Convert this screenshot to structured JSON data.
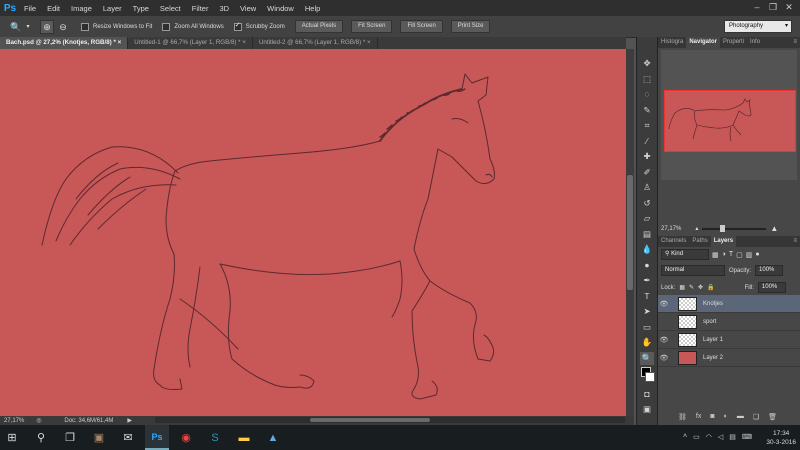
{
  "menubar": {
    "logo": "Ps",
    "items": [
      "File",
      "Edit",
      "Image",
      "Layer",
      "Type",
      "Select",
      "Filter",
      "3D",
      "View",
      "Window",
      "Help"
    ]
  },
  "options": {
    "resize_windows": "Resize Windows to Fit",
    "zoom_all": "Zoom All Windows",
    "scrubby_zoom": "Scrubby Zoom",
    "actual_pixels": "Actual Pixels",
    "fit_screen": "Fit Screen",
    "fill_screen": "Fill Screen",
    "print_size": "Print Size",
    "workspace": "Photography",
    "scrubby_checked": true
  },
  "tabs": [
    {
      "label": "Bach.psd @ 27,2% (Knotjes, RGB/8) *",
      "active": true
    },
    {
      "label": "Untitled-1 @ 66,7% (Layer 1, RGB/8) *",
      "active": false
    },
    {
      "label": "Untitled-2 @ 66,7% (Layer 1, RGB/8) *",
      "active": false
    }
  ],
  "canvas": {
    "color": "#c85757"
  },
  "status": {
    "zoom": "27,17%",
    "doc": "Doc: 34,6M/61,4M"
  },
  "nav_panel": {
    "tabs": [
      "Histogra",
      "Navigator",
      "Properti",
      "Info"
    ],
    "zoom": "27,17%"
  },
  "layers_panel": {
    "tabs": [
      "Channels",
      "Paths",
      "Layers"
    ],
    "filter": "Kind",
    "blend_mode": "Normal",
    "opacity_label": "Opacity:",
    "opacity": "100%",
    "lock_label": "Lock:",
    "fill_label": "Fill:",
    "fill": "100%",
    "layers": [
      {
        "name": "Knotjes",
        "visible": true,
        "selected": true,
        "thumb": "transparent"
      },
      {
        "name": "sport",
        "visible": false,
        "selected": false,
        "thumb": "transparent"
      },
      {
        "name": "Layer 1",
        "visible": true,
        "selected": false,
        "thumb": "transparent"
      },
      {
        "name": "Layer 2",
        "visible": true,
        "selected": false,
        "thumb": "red"
      }
    ]
  },
  "taskbar": {
    "time": "17:34",
    "date": "30-3-2016"
  }
}
